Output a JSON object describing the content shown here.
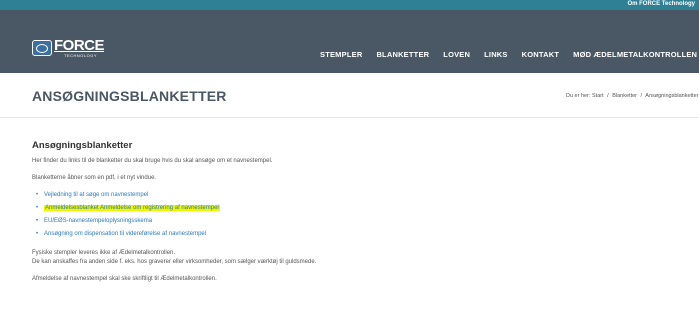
{
  "topbar": {
    "link": "Om FORCE Technology"
  },
  "logo": {
    "name": "FORCE",
    "sub": "TECHNOLOGY"
  },
  "menu": {
    "items": [
      {
        "label": "STEMPLER"
      },
      {
        "label": "BLANKETTER"
      },
      {
        "label": "LOVEN"
      },
      {
        "label": "LINKS"
      },
      {
        "label": "KONTAKT"
      },
      {
        "label": "MØD ÆDELMETALKONTROLLEN"
      }
    ]
  },
  "page": {
    "title": "ANSØGNINGSBLANKETTER",
    "breadcrumb": {
      "prefix": "Du er her:",
      "items": [
        "Start",
        "Blanketter",
        "Ansøgningsblanketter"
      ]
    }
  },
  "content": {
    "heading": "Ansøgningsblanketter",
    "intro": "Her finder du links til de blanketter du skal bruge hvis du skal ansøge om et navnestempel.",
    "note": "Blanketterne åbner som en pdf, i et nyt vindue.",
    "links": [
      {
        "label": "Vejledning til at søge om navnestempel"
      },
      {
        "label": "Anmeldelsesblanket Anmeldelse om registrering af navnestempel",
        "highlighted": true
      },
      {
        "label": "EU/EØS-navnestempeloplysningsskema"
      },
      {
        "label": "Ansøgning om dispensation til videreførelse af navnestempel"
      }
    ],
    "para1": "Fysiske stempler leveres ikke af Ædelmetalkontrollen.",
    "para2": "De kan anskaffes fra anden side f. eks. hos graverer eller virksomheder, som sælger værktøj til guldsmede.",
    "para3": "Afmeldelse af navnestempel skal ske skriftligt til Ædelmetalkontrollen."
  },
  "colors": {
    "topbar": "#2f7f95",
    "navbar": "#4a5764",
    "link": "#2b7bbd",
    "highlight": "#f0f500"
  }
}
